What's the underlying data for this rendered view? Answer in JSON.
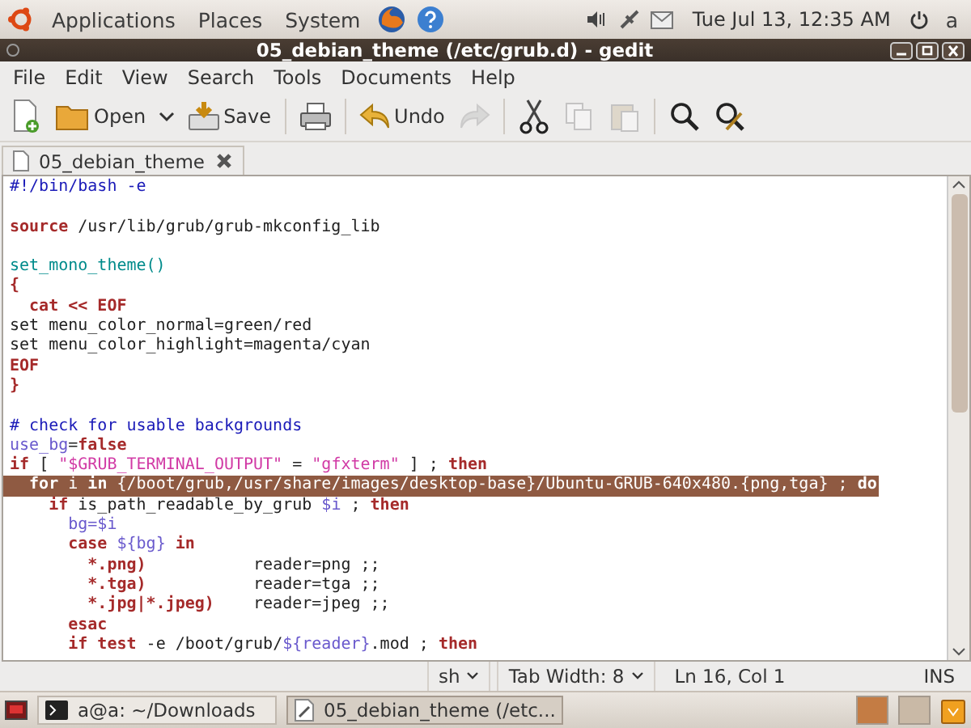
{
  "top_panel": {
    "menus": [
      "Applications",
      "Places",
      "System"
    ],
    "clock": "Tue Jul 13, 12:35 AM",
    "user": "a"
  },
  "window": {
    "title": "05_debian_theme (/etc/grub.d) - gedit"
  },
  "menu_bar": [
    "File",
    "Edit",
    "View",
    "Search",
    "Tools",
    "Documents",
    "Help"
  ],
  "toolbar": {
    "open": {
      "label": "Open"
    },
    "save": {
      "label": "Save"
    },
    "undo": {
      "label": "Undo"
    },
    "redo": {
      "disabled": true
    },
    "cut": {
      "disabled": false
    },
    "copy": {
      "disabled": true
    },
    "paste": {
      "disabled": true
    }
  },
  "tabs": [
    {
      "label": "05_debian_theme",
      "selected": true
    }
  ],
  "editor": {
    "lines": [
      {
        "selected": false,
        "tokens": [
          {
            "text": "#!/bin/bash -e",
            "kind": "comment"
          }
        ]
      },
      {
        "selected": false
      },
      {
        "selected": false,
        "tokens": [
          {
            "text": "source",
            "kind": "keyword"
          },
          {
            "text": " /usr/lib/grub/grub-mkconfig_lib",
            "kind": "plain"
          }
        ]
      },
      {
        "selected": false
      },
      {
        "selected": false,
        "tokens": [
          {
            "text": "set_mono_theme()",
            "kind": "function"
          }
        ]
      },
      {
        "selected": false,
        "tokens": [
          {
            "text": "{",
            "kind": "keyword"
          }
        ]
      },
      {
        "selected": false,
        "tokens": [
          {
            "text": "  cat << EOF",
            "kind": "keyword"
          }
        ]
      },
      {
        "selected": false,
        "tokens": [
          {
            "text": "set menu_color_normal=green/red",
            "kind": "plain"
          }
        ]
      },
      {
        "selected": false,
        "tokens": [
          {
            "text": "set menu_color_highlight=magenta/cyan",
            "kind": "plain"
          }
        ]
      },
      {
        "selected": false,
        "tokens": [
          {
            "text": "EOF",
            "kind": "keyword"
          }
        ]
      },
      {
        "selected": false,
        "tokens": [
          {
            "text": "}",
            "kind": "keyword"
          }
        ]
      },
      {
        "selected": false
      },
      {
        "selected": false,
        "tokens": [
          {
            "text": "# check for usable backgrounds",
            "kind": "comment"
          }
        ]
      },
      {
        "selected": false,
        "tokens": [
          {
            "text": "use_bg",
            "kind": "variable"
          },
          {
            "text": "=",
            "kind": "plain"
          },
          {
            "text": "false",
            "kind": "keyword"
          }
        ]
      },
      {
        "selected": false,
        "tokens": [
          {
            "text": "if",
            "kind": "keyword"
          },
          {
            "text": " [ ",
            "kind": "plain"
          },
          {
            "text": "\"$GRUB_TERMINAL_OUTPUT\"",
            "kind": "string"
          },
          {
            "text": " = ",
            "kind": "plain"
          },
          {
            "text": "\"gfxterm\"",
            "kind": "string"
          },
          {
            "text": " ] ; ",
            "kind": "plain"
          },
          {
            "text": "then",
            "kind": "keyword"
          }
        ]
      },
      {
        "selected": true,
        "tokens": [
          {
            "text": "  for",
            "kind": "keyword"
          },
          {
            "text": " i ",
            "kind": "plain"
          },
          {
            "text": "in",
            "kind": "keyword"
          },
          {
            "text": " {/boot/grub,/usr/share/images/desktop-base}/Ubuntu-GRUB-640x480.{png,tga} ; ",
            "kind": "plain"
          },
          {
            "text": "do",
            "kind": "keyword"
          }
        ]
      },
      {
        "selected": false,
        "tokens": [
          {
            "text": "    if",
            "kind": "keyword"
          },
          {
            "text": " is_path_readable_by_grub ",
            "kind": "plain"
          },
          {
            "text": "$i",
            "kind": "variable"
          },
          {
            "text": " ; ",
            "kind": "plain"
          },
          {
            "text": "then",
            "kind": "keyword"
          }
        ]
      },
      {
        "selected": false,
        "tokens": [
          {
            "text": "      bg=$i",
            "kind": "variable"
          }
        ]
      },
      {
        "selected": false,
        "tokens": [
          {
            "text": "      case ",
            "kind": "keyword"
          },
          {
            "text": "${bg}",
            "kind": "variable"
          },
          {
            "text": " in",
            "kind": "keyword"
          }
        ]
      },
      {
        "selected": false,
        "tokens": [
          {
            "text": "        *.png)",
            "kind": "keyword"
          },
          {
            "text": "           reader=png ;;",
            "kind": "plain"
          }
        ]
      },
      {
        "selected": false,
        "tokens": [
          {
            "text": "        *.tga)",
            "kind": "keyword"
          },
          {
            "text": "           reader=tga ;;",
            "kind": "plain"
          }
        ]
      },
      {
        "selected": false,
        "tokens": [
          {
            "text": "        *.jpg|*.jpeg)",
            "kind": "keyword"
          },
          {
            "text": "    reader=jpeg ;;",
            "kind": "plain"
          }
        ]
      },
      {
        "selected": false,
        "tokens": [
          {
            "text": "      esac",
            "kind": "keyword"
          }
        ]
      },
      {
        "selected": false,
        "tokens": [
          {
            "text": "      if test",
            "kind": "keyword"
          },
          {
            "text": " -e /boot/grub/",
            "kind": "plain"
          },
          {
            "text": "${reader}",
            "kind": "variable"
          },
          {
            "text": ".mod ; ",
            "kind": "plain"
          },
          {
            "text": "then",
            "kind": "keyword"
          }
        ]
      }
    ]
  },
  "status_bar": {
    "language": "sh",
    "tab_width": "Tab Width: 8",
    "position": "Ln 16, Col 1",
    "mode": "INS"
  },
  "taskbar": [
    {
      "label": "a@a: ~/Downloads",
      "selected": false,
      "kind": "terminal"
    },
    {
      "label": "05_debian_theme (/etc...",
      "selected": true,
      "kind": "editor"
    }
  ]
}
